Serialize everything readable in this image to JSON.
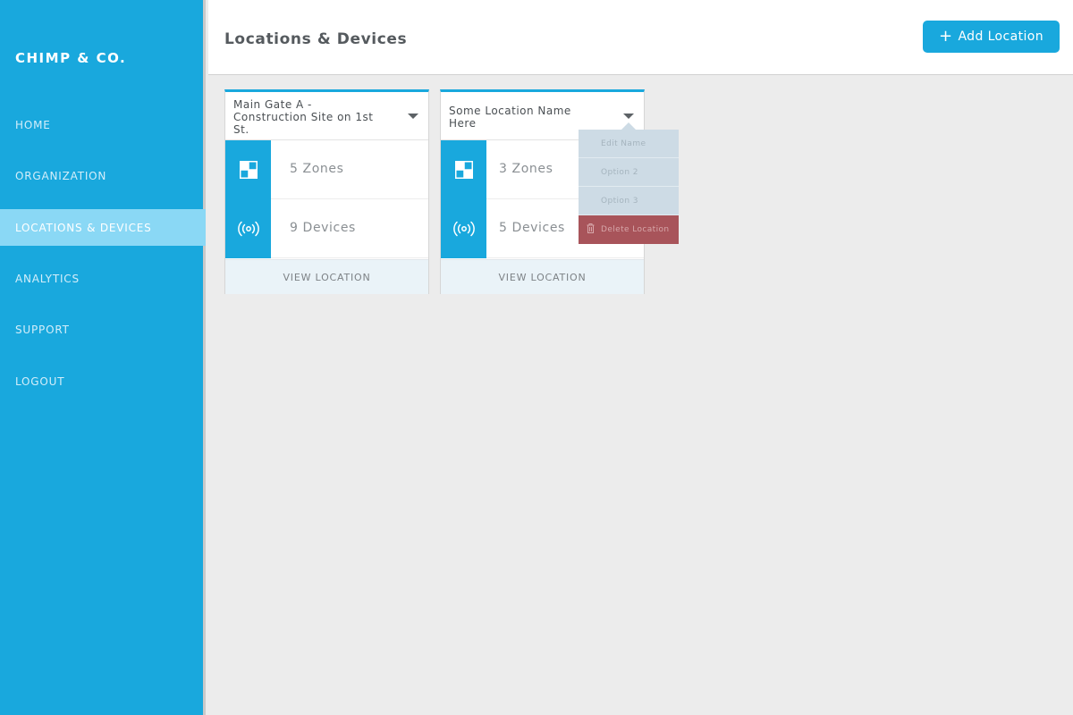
{
  "sidebar": {
    "brand": "CHIMP & CO.",
    "items": [
      {
        "label": "HOME"
      },
      {
        "label": "ORGANIZATION"
      },
      {
        "label": "LOCATIONS & DEVICES",
        "active": true
      },
      {
        "label": "ANALYTICS"
      },
      {
        "label": "SUPPORT"
      },
      {
        "label": "LOGOUT"
      }
    ]
  },
  "header": {
    "title": "Locations & Devices",
    "add_button_label": "Add Location",
    "add_button_icon": "plus-icon"
  },
  "locations": [
    {
      "name": "Main Gate A - Construction Site on 1st St.",
      "zones": "5 Zones",
      "devices": "9 Devices",
      "view_label": "VIEW LOCATION"
    },
    {
      "name": "Some Location Name Here",
      "zones": "3 Zones",
      "devices": "5 Devices",
      "view_label": "VIEW LOCATION"
    }
  ],
  "dropdown_menu": {
    "items": [
      "Edit Name",
      "Option 2",
      "Option 3"
    ],
    "delete_label": "Delete Location"
  },
  "colors": {
    "primary": "#19a8dd",
    "active_nav": "#8ad8f5",
    "danger": "#a8545a",
    "background": "#ececec"
  }
}
